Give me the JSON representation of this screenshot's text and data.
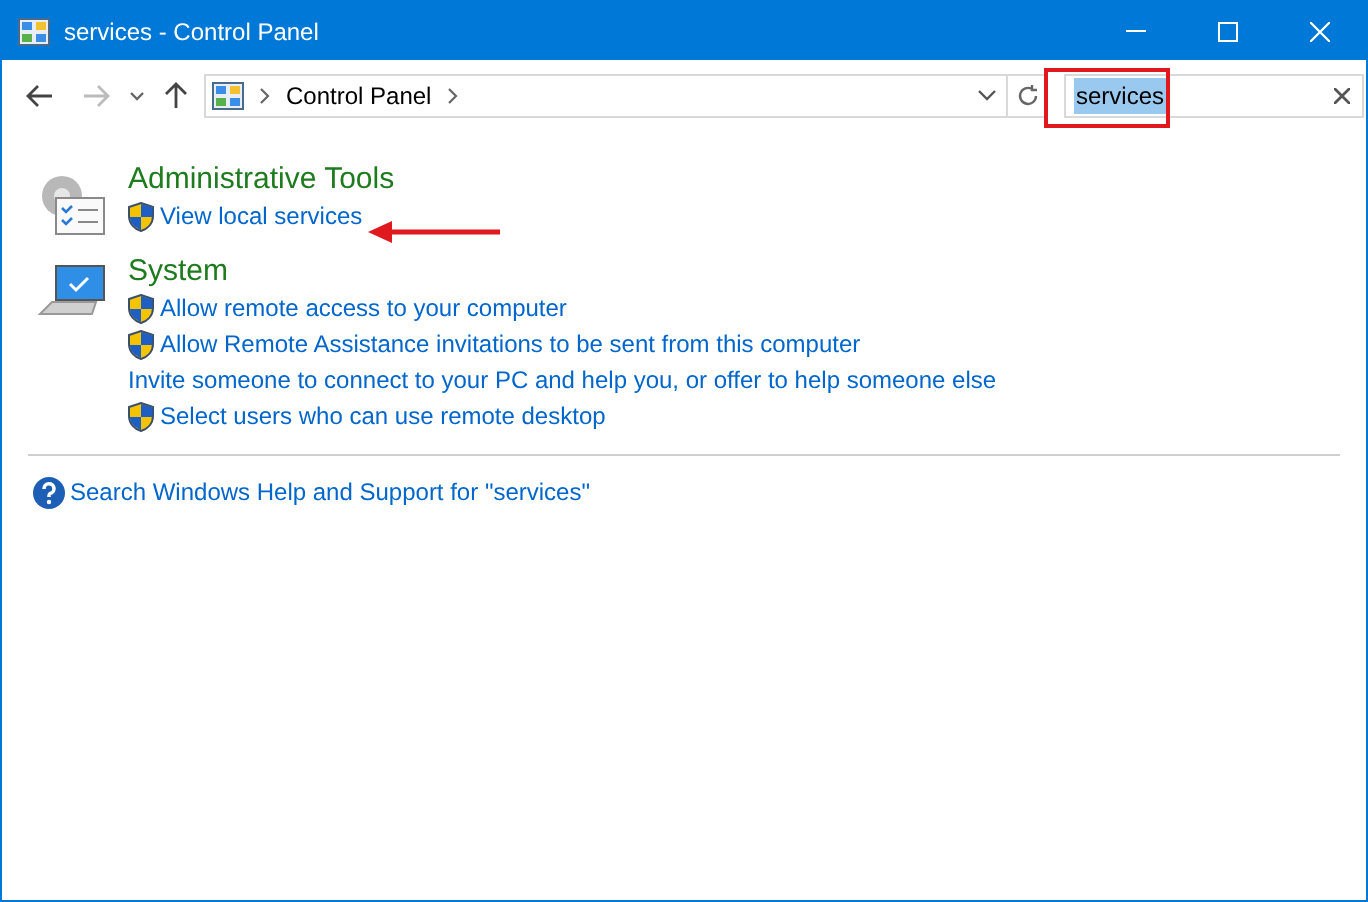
{
  "window": {
    "title": "services - Control Panel"
  },
  "address_bar": {
    "crumbs": [
      "Control Panel"
    ]
  },
  "search": {
    "value": "services",
    "value_selected": true
  },
  "sections": [
    {
      "kind": "tools",
      "title": "Administrative Tools",
      "links": [
        {
          "label": "View local services",
          "shield": true
        }
      ]
    },
    {
      "kind": "system",
      "title": "System",
      "links": [
        {
          "label": "Allow remote access to your computer",
          "shield": true
        },
        {
          "label": "Allow Remote Assistance invitations to be sent from this computer",
          "shield": true
        },
        {
          "label": "Invite someone to connect to your PC and help you, or offer to help someone else",
          "shield": false
        },
        {
          "label": "Select users who can use remote desktop",
          "shield": true
        }
      ]
    }
  ],
  "help_link": "Search Windows Help and Support for \"services\""
}
